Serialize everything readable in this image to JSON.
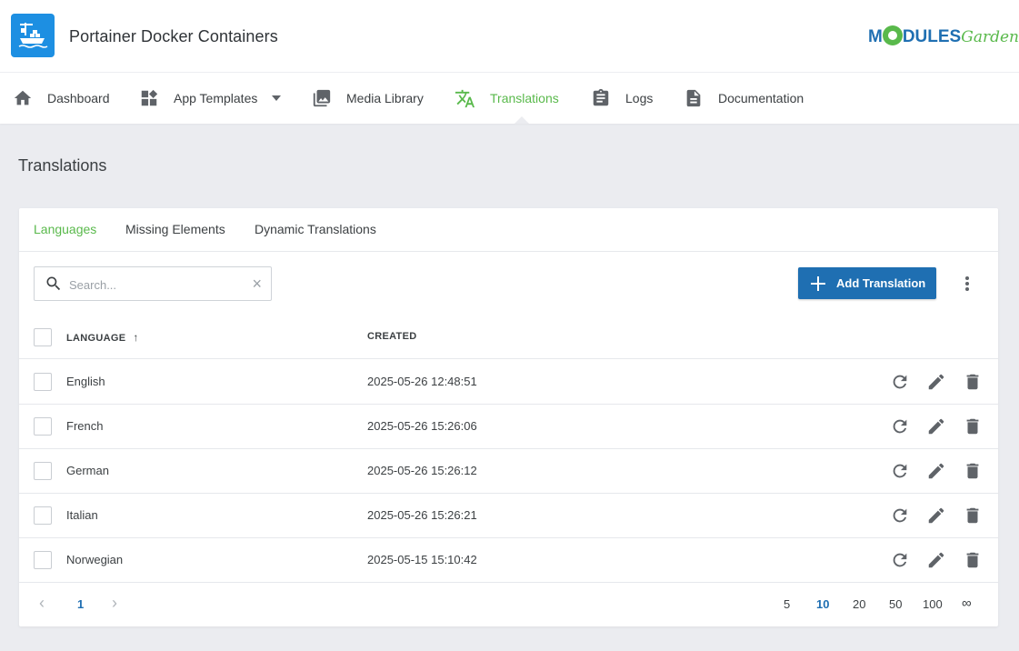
{
  "header": {
    "app_title": "Portainer Docker Containers",
    "brand_prefix": "M",
    "brand_main": "DULES",
    "brand_suffix": "Garden",
    "colors": {
      "primary": "#1f6fb2",
      "accent": "#59b94b",
      "logo_bg": "#1d8fe2"
    }
  },
  "nav": {
    "items": [
      {
        "label": "Dashboard",
        "icon": "home-icon"
      },
      {
        "label": "App Templates",
        "icon": "widgets-icon"
      },
      {
        "label": "Media Library",
        "icon": "image-library-icon"
      },
      {
        "label": "Translations",
        "icon": "translate-icon",
        "active": true
      },
      {
        "label": "Logs",
        "icon": "clipboard-icon"
      },
      {
        "label": "Documentation",
        "icon": "document-icon"
      }
    ]
  },
  "page": {
    "title": "Translations"
  },
  "tabs": [
    {
      "label": "Languages",
      "active": true
    },
    {
      "label": "Missing Elements"
    },
    {
      "label": "Dynamic Translations"
    }
  ],
  "toolbar": {
    "search_placeholder": "Search...",
    "search_value": "",
    "clear_symbol": "×",
    "add_label": "Add Translation"
  },
  "table": {
    "columns": {
      "language": "LANGUAGE",
      "created": "CREATED",
      "sort_arrow": "↑"
    },
    "rows": [
      {
        "language": "English",
        "created": "2025-05-26 12:48:51"
      },
      {
        "language": "French",
        "created": "2025-05-26 15:26:06"
      },
      {
        "language": "German",
        "created": "2025-05-26 15:26:12"
      },
      {
        "language": "Italian",
        "created": "2025-05-26 15:26:21"
      },
      {
        "language": "Norwegian",
        "created": "2025-05-15 15:10:42"
      }
    ]
  },
  "pagination": {
    "prev": "‹",
    "next": "›",
    "current_page": "1",
    "page_sizes": [
      "5",
      "10",
      "20",
      "50",
      "100",
      "∞"
    ],
    "selected_size": "10"
  }
}
